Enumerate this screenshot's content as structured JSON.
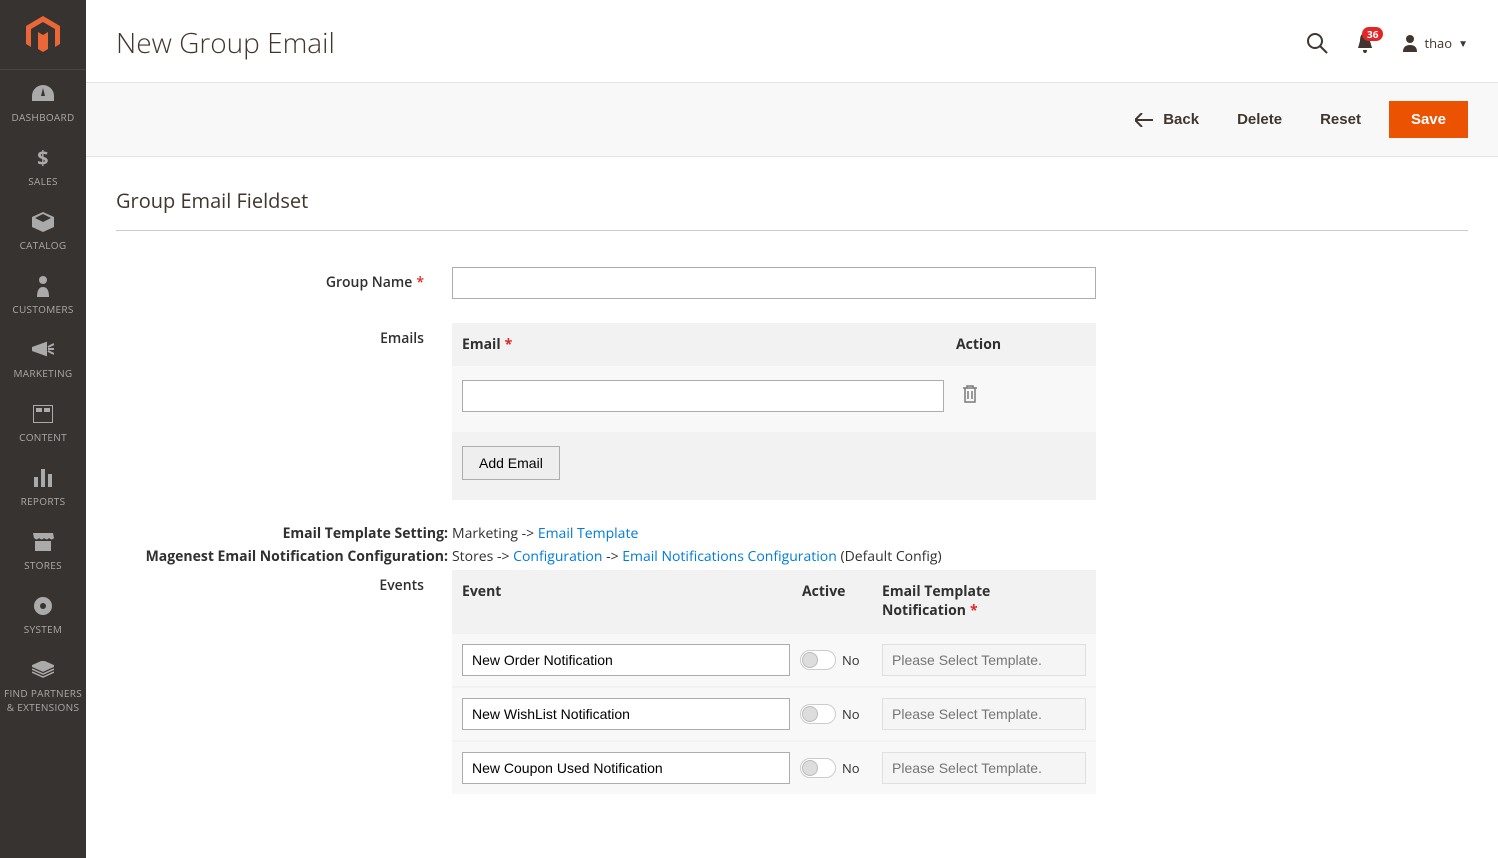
{
  "sidebar": {
    "items": [
      {
        "label": "DASHBOARD",
        "icon": "dashboard"
      },
      {
        "label": "SALES",
        "icon": "dollar"
      },
      {
        "label": "CATALOG",
        "icon": "box"
      },
      {
        "label": "CUSTOMERS",
        "icon": "person"
      },
      {
        "label": "MARKETING",
        "icon": "megaphone"
      },
      {
        "label": "CONTENT",
        "icon": "layout"
      },
      {
        "label": "REPORTS",
        "icon": "bars"
      },
      {
        "label": "STORES",
        "icon": "store"
      },
      {
        "label": "SYSTEM",
        "icon": "gear"
      },
      {
        "label": "FIND PARTNERS & EXTENSIONS",
        "icon": "partners"
      }
    ]
  },
  "header": {
    "title": "New Group Email",
    "notifications_count": "36",
    "username": "thao"
  },
  "toolbar": {
    "back": "Back",
    "delete": "Delete",
    "reset": "Reset",
    "save": "Save"
  },
  "section": {
    "title": "Group Email Fieldset"
  },
  "form": {
    "group_name_label": "Group Name",
    "group_name_value": "",
    "emails_label": "Emails",
    "emails_header_email": "Email",
    "emails_header_action": "Action",
    "email_value": "",
    "add_email_button": "Add Email",
    "setting1_label": "Email Template Setting:",
    "setting1_prefix": "Marketing -> ",
    "setting1_link": "Email Template",
    "setting2_label": "Magenest Email Notification Configuration:",
    "setting2_prefix": "Stores -> ",
    "setting2_link1": "Configuration",
    "setting2_sep": " -> ",
    "setting2_link2": "Email Notifications Configuration",
    "setting2_suffix": " (Default Config)",
    "events_label": "Events",
    "events_header_event": "Event",
    "events_header_active": "Active",
    "events_header_template": "Email Template Notification",
    "toggle_no": "No",
    "template_placeholder": "Please Select Template.",
    "events": [
      {
        "name": "New Order Notification"
      },
      {
        "name": "New WishList Notification"
      },
      {
        "name": "New Coupon Used Notification"
      }
    ]
  }
}
